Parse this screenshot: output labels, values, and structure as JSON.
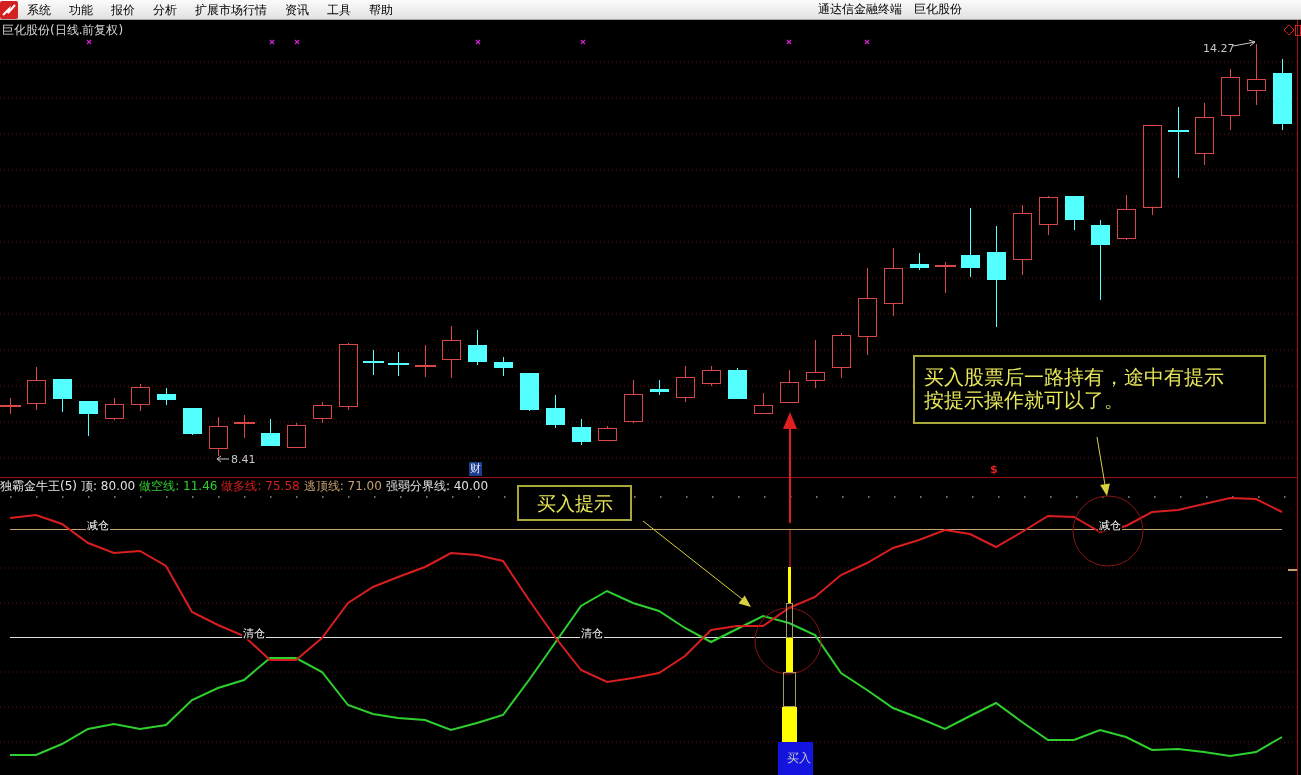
{
  "menu_bar": {
    "items": [
      "系统",
      "功能",
      "报价",
      "分析",
      "扩展市场行情",
      "资讯",
      "工具",
      "帮助"
    ],
    "app_title": "通达信金融终端",
    "stock_name": "巨化股份"
  },
  "price_chart": {
    "title": "巨化股份(日线.前复权)",
    "high_label": "14.27",
    "low_label": "8.41",
    "event_badges": [
      {
        "kind": "finance",
        "text": "财"
      },
      {
        "kind": "dollar",
        "text": "$"
      }
    ]
  },
  "indicator": {
    "name": "独霸金牛王(5)",
    "legend": [
      {
        "text": "顶: 80.00",
        "color": "#e0e0e0"
      },
      {
        "text": "做空线: 11.46",
        "color": "#2ed02e"
      },
      {
        "text": "做多线: 75.58",
        "color": "#d81e1e"
      },
      {
        "text": "逃顶线: 71.00",
        "color": "#c8a070"
      },
      {
        "text": "强弱分界线: 40.00",
        "color": "#e0e0e0"
      }
    ],
    "zone_labels": [
      "减仓",
      "清仓",
      "清仓",
      "减仓"
    ],
    "signal_label": "买入"
  },
  "callouts": [
    {
      "lines": [
        "买入提示"
      ]
    },
    {
      "lines": [
        "买入股票后一路持有，途中有提示",
        "按提示操作就可以了。"
      ]
    }
  ]
}
